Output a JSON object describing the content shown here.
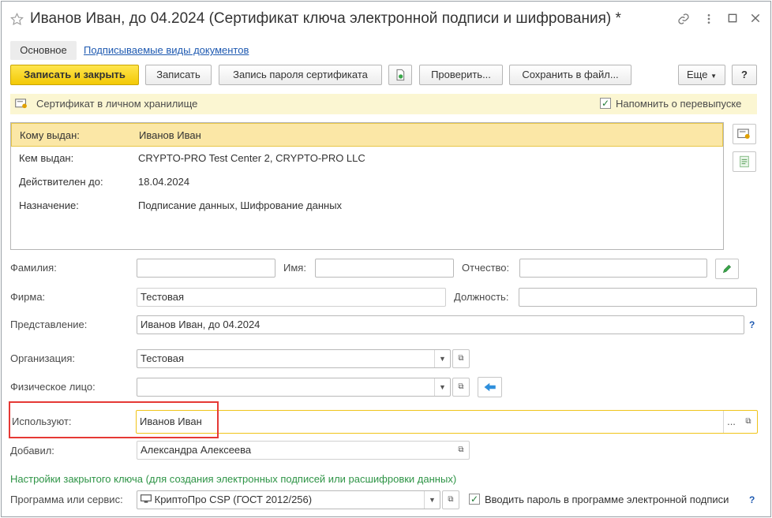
{
  "window": {
    "title": "Иванов Иван, до 04.2024 (Сертификат ключа электронной подписи и шифрования) *"
  },
  "tabs": {
    "main": "Основное",
    "signed_doc_types": "Подписываемые виды документов"
  },
  "toolbar": {
    "save_close": "Записать и закрыть",
    "save": "Записать",
    "cert_password": "Запись пароля сертификата",
    "check": "Проверить...",
    "save_file": "Сохранить в файл...",
    "more": "Еще",
    "help": "?"
  },
  "infobar": {
    "text": "Сертификат в личном хранилище",
    "remind_label": "Напомнить о перевыпуске",
    "remind_checked": true
  },
  "certificate": {
    "rows": [
      {
        "label": "Кому выдан:",
        "value": "Иванов Иван"
      },
      {
        "label": "Кем выдан:",
        "value": "CRYPTO-PRO Test Center 2, CRYPTO-PRO LLC"
      },
      {
        "label": "Действителен до:",
        "value": "18.04.2024"
      },
      {
        "label": "Назначение:",
        "value": "Подписание данных, Шифрование данных"
      }
    ]
  },
  "fields": {
    "surname_label": "Фамилия:",
    "surname_value": "",
    "name_label": "Имя:",
    "name_value": "",
    "patronymic_label": "Отчество:",
    "patronymic_value": "",
    "firm_label": "Фирма:",
    "firm_value": "Тестовая",
    "position_label": "Должность:",
    "position_value": "",
    "presentation_label": "Представление:",
    "presentation_value": "Иванов Иван, до 04.2024",
    "organization_label": "Организация:",
    "organization_value": "Тестовая",
    "individual_label": "Физическое лицо:",
    "individual_value": "",
    "users_label": "Используют:",
    "users_value": "Иванов Иван",
    "added_label": "Добавил:",
    "added_value": "Александра Алексеева"
  },
  "private_key": {
    "section_title": "Настройки закрытого ключа (для создания электронных подписей или расшифровки данных)",
    "program_label": "Программа или сервис:",
    "program_value": "КриптоПро CSP (ГОСТ 2012/256)",
    "enter_password_label": "Вводить пароль в программе электронной подписи",
    "enter_password_checked": true
  },
  "colors": {
    "primary_button": "#f3c905",
    "selection_row": "#fbe7a6",
    "info_bar": "#fbf6d2",
    "link": "#1f5ab1",
    "section_green": "#2e9446",
    "highlight_red": "#e53935",
    "active_field_border": "#f0c419"
  }
}
